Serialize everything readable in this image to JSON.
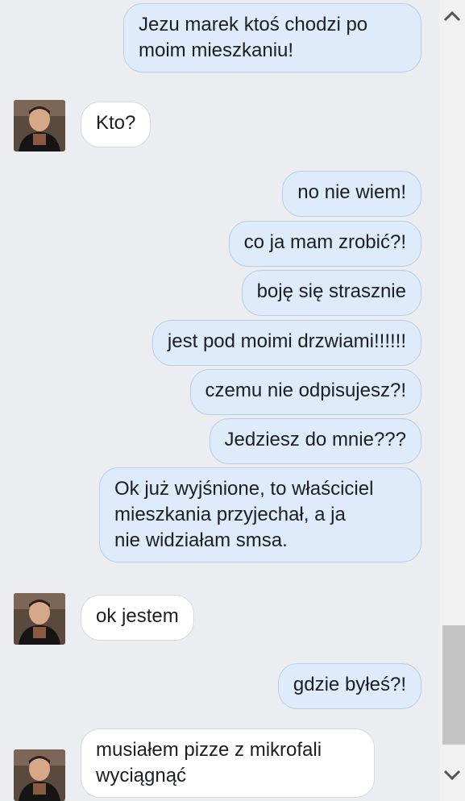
{
  "messages": [
    {
      "from": "me",
      "text": "Jezu marek ktoś chodzi po\nmoim mieszkaniu!"
    },
    {
      "from": "other",
      "text": "Kto?"
    },
    {
      "from": "me",
      "text": "no nie wiem!"
    },
    {
      "from": "me",
      "text": "co ja mam zrobić?!"
    },
    {
      "from": "me",
      "text": "boję się strasznie"
    },
    {
      "from": "me",
      "text": "jest pod moimi drzwiami!!!!!!"
    },
    {
      "from": "me",
      "text": "czemu nie odpisujesz?!"
    },
    {
      "from": "me",
      "text": "Jedziesz do mnie???"
    },
    {
      "from": "me",
      "text": "Ok już wyjśnione, to właściciel\nmieszkania przyjechał, a ja\nnie widziałam smsa."
    },
    {
      "from": "other",
      "text": "ok jestem"
    },
    {
      "from": "me",
      "text": "gdzie byłeś?!"
    },
    {
      "from": "other",
      "text": "musiałem pizze z mikrofali\nwyciągnąć"
    }
  ],
  "colors": {
    "outgoing_bubble": "#ddebfa",
    "incoming_bubble": "#ffffff",
    "background": "#ebedf0"
  },
  "icons": {
    "scroll_up": "chevron-up-icon",
    "scroll_down": "chevron-down-icon",
    "avatar": "contact-avatar"
  }
}
